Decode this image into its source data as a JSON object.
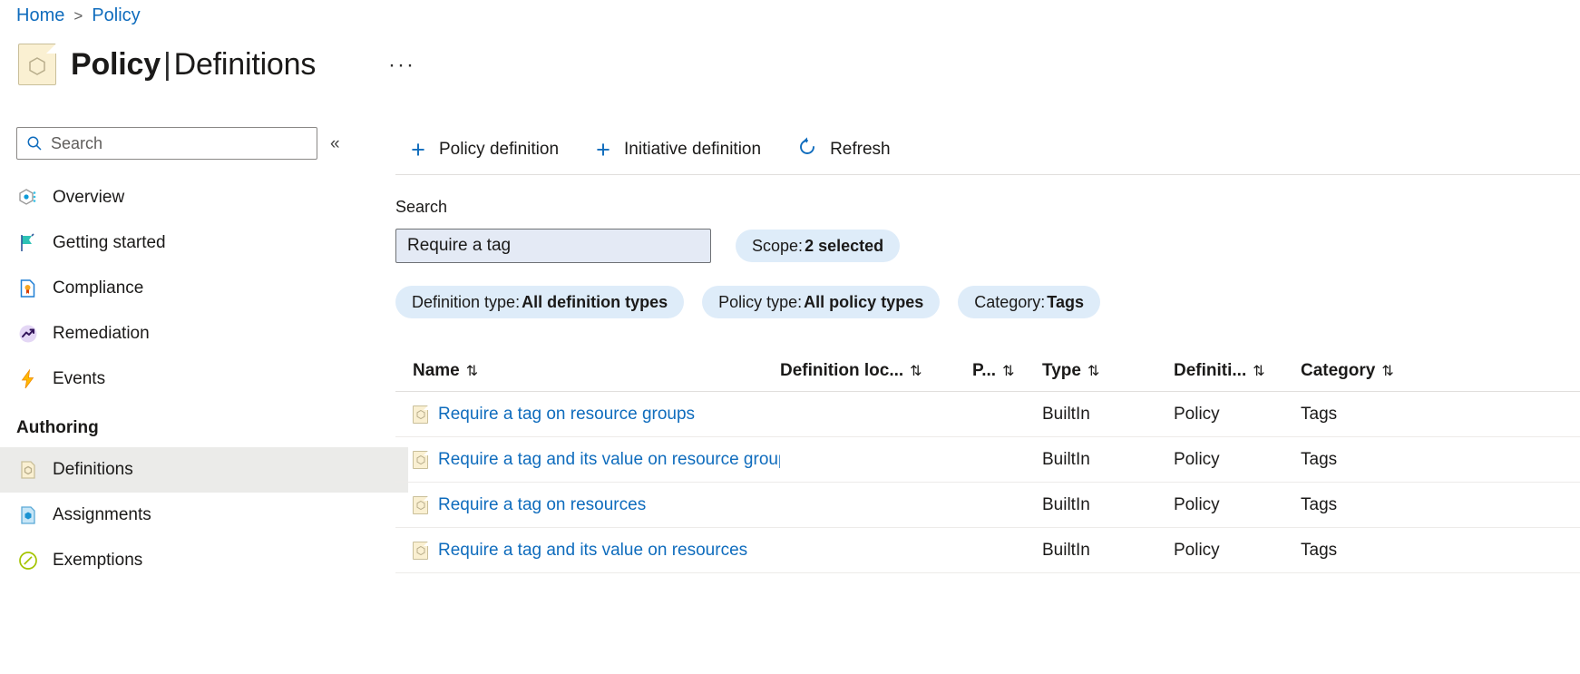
{
  "breadcrumb": {
    "home": "Home",
    "separator": ">",
    "current": "Policy"
  },
  "header": {
    "title_main": "Policy",
    "title_sep": "|",
    "title_sub": "Definitions",
    "more_label": "···"
  },
  "sidebar": {
    "search_placeholder": "Search",
    "collapse_label": "«",
    "items": [
      {
        "label": "Overview",
        "icon": "overview-hexagon-icon"
      },
      {
        "label": "Getting started",
        "icon": "flag-icon"
      },
      {
        "label": "Compliance",
        "icon": "compliance-document-icon"
      },
      {
        "label": "Remediation",
        "icon": "remediation-trend-icon"
      },
      {
        "label": "Events",
        "icon": "lightning-bolt-icon"
      }
    ],
    "group_label": "Authoring",
    "authoring_items": [
      {
        "label": "Definitions",
        "icon": "definition-document-icon",
        "selected": true
      },
      {
        "label": "Assignments",
        "icon": "assignment-document-icon",
        "selected": false
      },
      {
        "label": "Exemptions",
        "icon": "exemption-circle-slash-icon",
        "selected": false
      }
    ]
  },
  "toolbar": {
    "policy_definition": "Policy definition",
    "initiative_definition": "Initiative definition",
    "refresh": "Refresh",
    "plus_glyph": "+"
  },
  "filters": {
    "search_label": "Search",
    "search_value": "Require a tag",
    "search_placeholder": "Search",
    "pills": [
      {
        "name": "Scope",
        "sep": " : ",
        "value": "2 selected"
      },
      {
        "name": "Definition type",
        "sep": " : ",
        "value": "All definition types"
      },
      {
        "name": "Policy type",
        "sep": " : ",
        "value": "All policy types"
      },
      {
        "name": "Category",
        "sep": " : ",
        "value": "Tags"
      }
    ]
  },
  "table": {
    "sort_glyph": "⇅",
    "columns": [
      "Name",
      "Definition loc...",
      "P...",
      "Type",
      "Definiti...",
      "Category"
    ],
    "rows": [
      {
        "name": "Require a tag on resource groups",
        "definition_location": "",
        "p": "",
        "type": "BuiltIn",
        "definition_type": "Policy",
        "category": "Tags"
      },
      {
        "name": "Require a tag and its value on resource groups",
        "definition_location": "",
        "p": "",
        "type": "BuiltIn",
        "definition_type": "Policy",
        "category": "Tags"
      },
      {
        "name": "Require a tag on resources",
        "definition_location": "",
        "p": "",
        "type": "BuiltIn",
        "definition_type": "Policy",
        "category": "Tags"
      },
      {
        "name": "Require a tag and its value on resources",
        "definition_location": "",
        "p": "",
        "type": "BuiltIn",
        "definition_type": "Policy",
        "category": "Tags"
      }
    ]
  },
  "colors": {
    "link": "#0f6cbd",
    "pill_bg": "#deecf9",
    "search_bg": "#e4eaf5",
    "selected_nav": "#ebebe9"
  }
}
